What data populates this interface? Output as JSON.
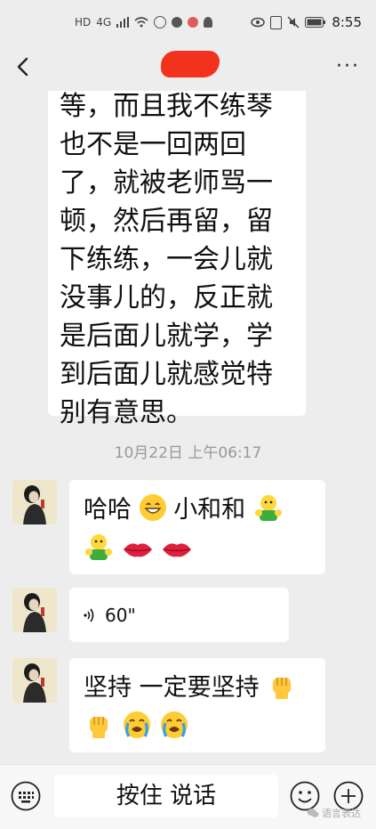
{
  "status_bar": {
    "left_icons": [
      "HD",
      "4G",
      "signal-icon",
      "wifi-icon",
      "app-icon",
      "app-icon",
      "app-icon",
      "app-icon"
    ],
    "time": "8:55",
    "right_icons": [
      "eye-icon",
      "nfc-icon",
      "mute-icon",
      "battery-icon"
    ]
  },
  "header": {
    "title": "",
    "more_label": "···"
  },
  "messages": {
    "long_text": "等，而且我不练琴也不是一回两回了，就被老师骂一顿，然后再留，留下练练，一会儿就没事儿的，反正就是后面儿就学，学到后面儿就感觉特别有意思。",
    "timestamp": "10月22日 上午06:17",
    "msg1_text_a": "哈哈",
    "msg1_text_b": " 小和和",
    "voice_icon": "🔊",
    "voice_duration": "60\"",
    "msg3_text": "坚持 一定要坚持"
  },
  "input_bar": {
    "hold_to_talk": "按住 说话"
  },
  "watermark": {
    "text": "语言表达"
  },
  "colors": {
    "background": "#ededed",
    "bubble": "#ffffff",
    "redaction": "#f2321c"
  }
}
